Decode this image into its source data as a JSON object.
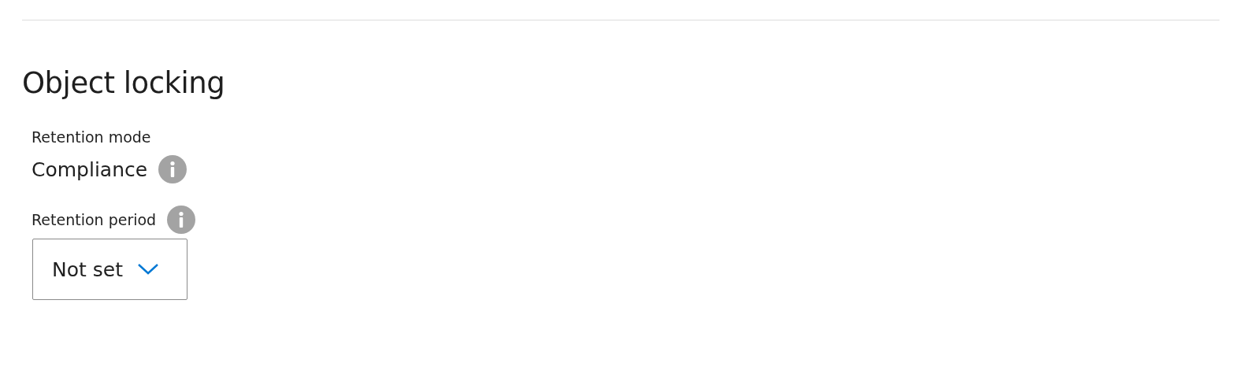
{
  "section": {
    "title": "Object locking"
  },
  "retention_mode": {
    "label": "Retention mode",
    "value": "Compliance"
  },
  "retention_period": {
    "label": "Retention period",
    "dropdown": {
      "value": "Not set"
    }
  }
}
